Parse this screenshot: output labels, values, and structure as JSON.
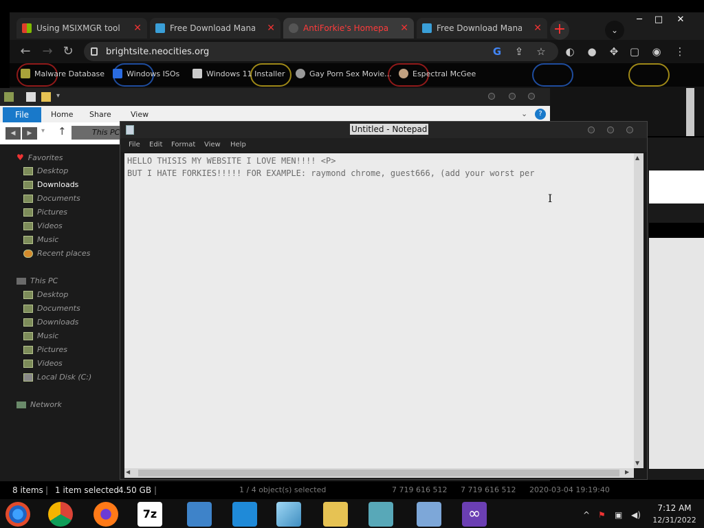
{
  "chrome": {
    "tabs": [
      {
        "label": "Using MSIXMGR tool - /",
        "icon_color": "#e13f2b",
        "active": false
      },
      {
        "label": "Free Download Manager",
        "icon_color": "#3a9fd8",
        "active": false
      },
      {
        "label": "AntiForkie's Homepage",
        "icon_color": "#888888",
        "active": true
      },
      {
        "label": "Free Download Manager",
        "icon_color": "#3a9fd8",
        "active": false
      }
    ],
    "url": "brightsite.neocities.org",
    "bookmarks": [
      {
        "label": "Malware Database"
      },
      {
        "label": "Windows ISOs"
      },
      {
        "label": "Windows 11 Installer"
      },
      {
        "label": "Gay Porn Sex Movie..."
      },
      {
        "label": "Espectral McGee"
      }
    ]
  },
  "explorer": {
    "ribbon_tabs": {
      "file": "File",
      "home": "Home",
      "share": "Share",
      "view": "View"
    },
    "breadcrumb": "This PC",
    "favorites_label": "Favorites",
    "favorites": [
      "Desktop",
      "Downloads",
      "Documents",
      "Pictures",
      "Videos",
      "Music",
      "Recent places"
    ],
    "thispc_label": "This PC",
    "thispc": [
      "Desktop",
      "Documents",
      "Downloads",
      "Music",
      "Pictures",
      "Videos",
      "Local Disk (C:)"
    ],
    "network_label": "Network",
    "status": {
      "items": "8 items",
      "selected": "1 item selected",
      "size": "4.50 GB",
      "objects": "1 / 4 object(s) selected",
      "free1": "7 719 616 512",
      "free2": "7 719 616 512",
      "date": "2020-03-04 19:19:40"
    }
  },
  "notepad": {
    "title": "Untitled - Notepad",
    "menu": {
      "file": "File",
      "edit": "Edit",
      "format": "Format",
      "view": "View",
      "help": "Help"
    },
    "lines": [
      "HELLO THISIS MY WEBSITE I LOVE MEN!!!! <P>",
      "BUT I HATE FORKIES!!!!! FOR EXAMPLE: raymond chrome, guest666, (add your worst per"
    ]
  },
  "taskbar": {
    "time": "7:12 AM",
    "date": "12/31/2022"
  }
}
